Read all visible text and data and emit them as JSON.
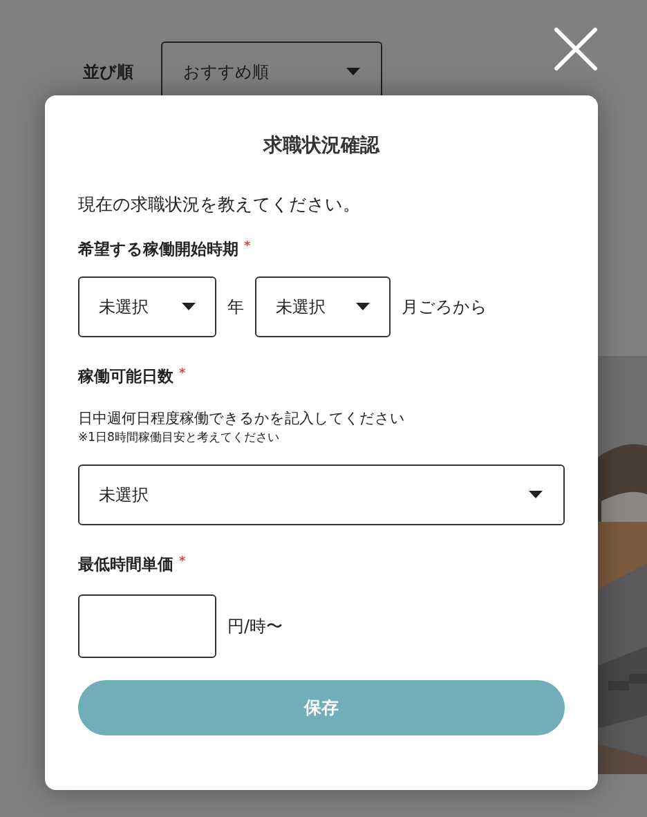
{
  "background": {
    "sort": {
      "label": "並び順",
      "value": "おすすめ順"
    }
  },
  "modal": {
    "title": "求職状況確認",
    "intro": "現在の求職状況を教えてください。",
    "fields": [
      {
        "kind": "date",
        "label": "希望する稼働開始時期",
        "required_mark": "*",
        "selects": [
          {
            "value": "未選択",
            "suffix": "年"
          },
          {
            "value": "未選択",
            "suffix": "月ごろから"
          }
        ]
      },
      {
        "kind": "select",
        "label": "稼働可能日数",
        "required_mark": "*",
        "help": "日中週何日程度稼働できるかを記入してください",
        "note": "※1日8時間稼働目安と考えてください",
        "value": "未選択"
      },
      {
        "kind": "input",
        "label": "最低時間単価",
        "required_mark": "*",
        "suffix": "円/時〜"
      }
    ],
    "save_button": "保存"
  }
}
